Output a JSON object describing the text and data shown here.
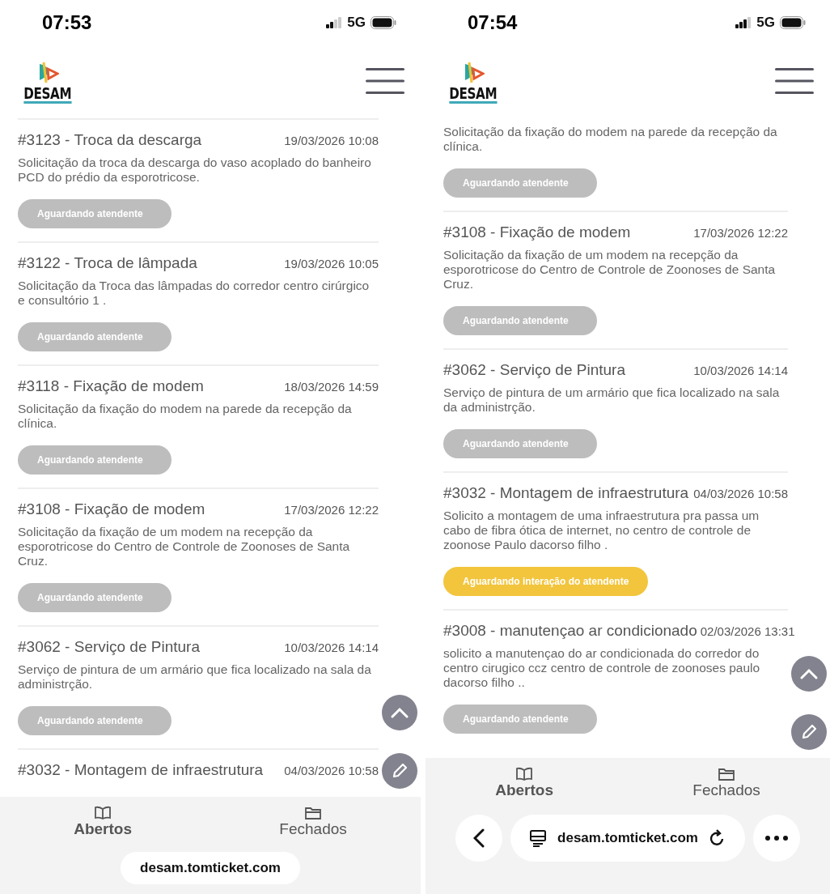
{
  "screens": [
    {
      "status_bar": {
        "time": "07:53",
        "network": "5G"
      },
      "logo": "DESAM",
      "tickets": [
        {
          "title": "#3123 - Troca da descarga",
          "date": "19/03/2026 10:08",
          "description": "Solicitação da troca da descarga do vaso acoplado do banheiro PCD do prédio da esporotricose.",
          "status": {
            "label": "Aguardando atendente",
            "kind": "waiting"
          }
        },
        {
          "title": "#3122 - Troca de lâmpada",
          "date": "19/03/2026 10:05",
          "description": "Solicitação da Troca das lâmpadas do corredor centro cirúrgico e consultório 1 .",
          "status": {
            "label": "Aguardando atendente",
            "kind": "waiting"
          }
        },
        {
          "title": "#3118 - Fixação de modem",
          "date": "18/03/2026 14:59",
          "description": "Solicitação da fixação do modem na parede da recepção da clínica.",
          "status": {
            "label": "Aguardando atendente",
            "kind": "waiting"
          }
        },
        {
          "title": "#3108 - Fixação de modem",
          "date": "17/03/2026 12:22",
          "description": "Solicitação da fixação de um modem na recepção da esporotricose do Centro de Controle de Zoonoses de Santa Cruz.",
          "status": {
            "label": "Aguardando atendente",
            "kind": "waiting"
          }
        },
        {
          "title": "#3062 - Serviço de Pintura",
          "date": "10/03/2026 14:14",
          "description": "Serviço de pintura de um armário que fica localizado na sala da administrção.",
          "status": {
            "label": "Aguardando atendente",
            "kind": "waiting"
          }
        },
        {
          "title": "#3032 - Montagem de infraestrutura",
          "date": "04/03/2026 10:58"
        }
      ],
      "tabs": [
        {
          "label": "Abertos",
          "selected": true
        },
        {
          "label": "Fechados",
          "selected": false
        }
      ],
      "browser_bar": {
        "kind": "compact",
        "url": "desam.tomticket.com"
      }
    },
    {
      "status_bar": {
        "time": "07:54",
        "network": "5G"
      },
      "logo": "DESAM",
      "tickets": [
        {
          "description": "Solicitação da fixação do modem na parede da recepção da clínica.",
          "status": {
            "label": "Aguardando atendente",
            "kind": "waiting"
          }
        },
        {
          "title": "#3108 - Fixação de modem",
          "date": "17/03/2026 12:22",
          "description": "Solicitação da fixação de um modem na recepção da esporotricose do Centro de Controle de Zoonoses de Santa Cruz.",
          "status": {
            "label": "Aguardando atendente",
            "kind": "waiting"
          }
        },
        {
          "title": "#3062 - Serviço de Pintura",
          "date": "10/03/2026 14:14",
          "description": "Serviço de pintura de um armário que fica localizado na sala da administrção.",
          "status": {
            "label": "Aguardando atendente",
            "kind": "waiting"
          }
        },
        {
          "title": "#3032 - Montagem de infraestrutura",
          "date": "04/03/2026 10:58",
          "description": "Solicito a montagem de uma infraestrutura pra passa um cabo de fibra ótica de internet, no centro de controle de zoonose Paulo dacorso filho .",
          "status": {
            "label": "Aguardando interação do atendente",
            "kind": "interaction"
          }
        },
        {
          "title": "#3008 - manutençao ar condicionado",
          "date": "02/03/2026 13:31",
          "description": "solicito a manutençao do ar condicionada do corredor do centro cirugico ccz centro de controle de zoonoses paulo dacorso filho ..",
          "status": {
            "label": "Aguardando atendente",
            "kind": "waiting"
          }
        }
      ],
      "tabs": [
        {
          "label": "Abertos",
          "selected": true
        },
        {
          "label": "Fechados",
          "selected": false
        }
      ],
      "browser_bar": {
        "kind": "full",
        "url": "desam.tomticket.com"
      }
    }
  ]
}
